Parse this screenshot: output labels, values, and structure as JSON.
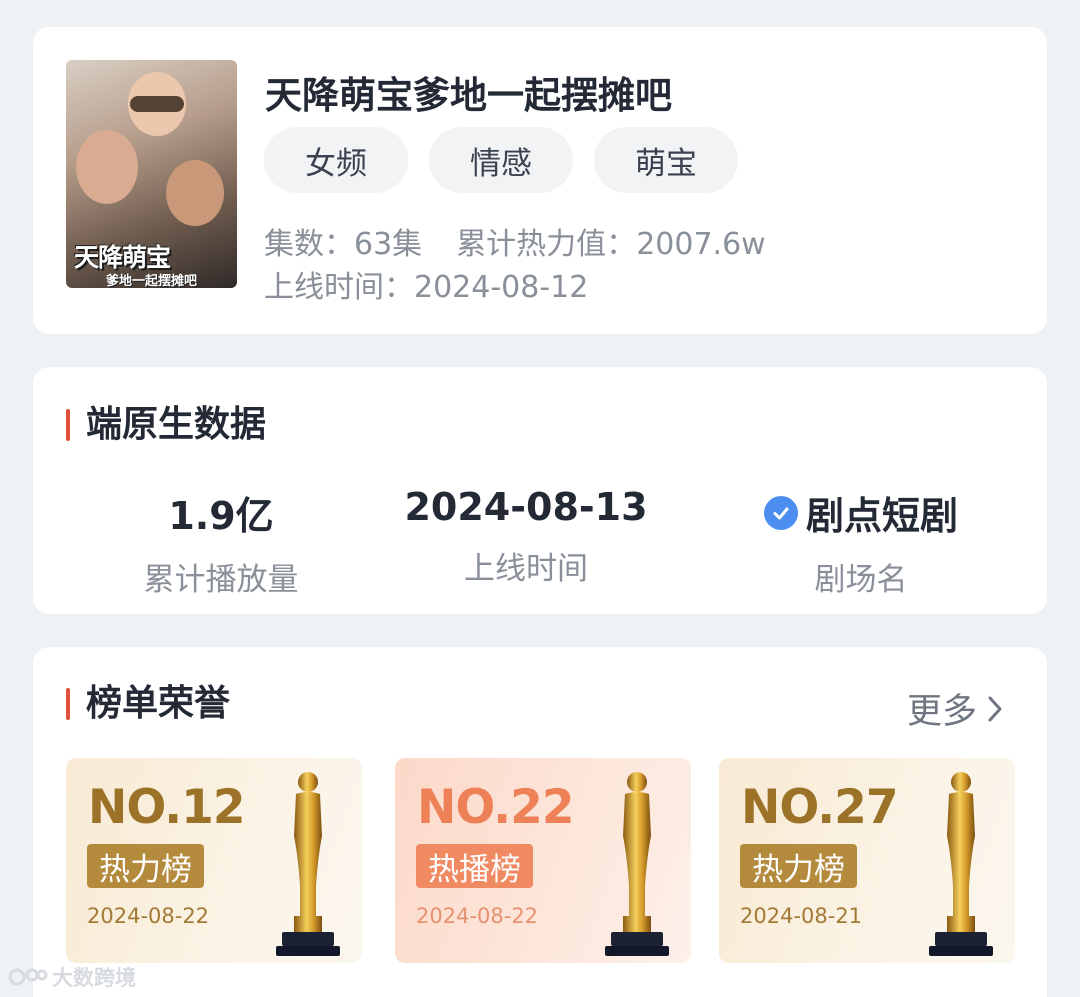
{
  "drama": {
    "title": "天降萌宝爹地一起摆摊吧",
    "poster_title": "天降萌宝",
    "poster_subtitle": "爹地一起摆摊吧",
    "tags": [
      "女频",
      "情感",
      "萌宝"
    ],
    "episodes_label": "集数：",
    "episodes_value": "63集",
    "heat_label": "累计热力值：",
    "heat_value": "2007.6w",
    "release_label": "上线时间：",
    "release_value": "2024-08-12"
  },
  "native": {
    "section_title": "端原生数据",
    "stats": [
      {
        "value": "1.9亿",
        "label": "累计播放量"
      },
      {
        "value": "2024-08-13",
        "label": "上线时间"
      },
      {
        "value": "剧点短剧",
        "label": "剧场名",
        "icon": "check-circle-icon"
      }
    ]
  },
  "rankings": {
    "section_title": "榜单荣誉",
    "more_label": "更多",
    "items": [
      {
        "no": "NO.12",
        "board": "热力榜",
        "date": "2024-08-22",
        "theme": "gold"
      },
      {
        "no": "NO.22",
        "board": "热播榜",
        "date": "2024-08-22",
        "theme": "peach"
      },
      {
        "no": "NO.27",
        "board": "热力榜",
        "date": "2024-08-21",
        "theme": "gold"
      }
    ]
  },
  "watermark": "大数跨境",
  "colors": {
    "accent_bar": "#e0503a",
    "gold_text": "#9c7228",
    "peach_text": "#ee8158",
    "verified_blue": "#4c8ef0"
  }
}
